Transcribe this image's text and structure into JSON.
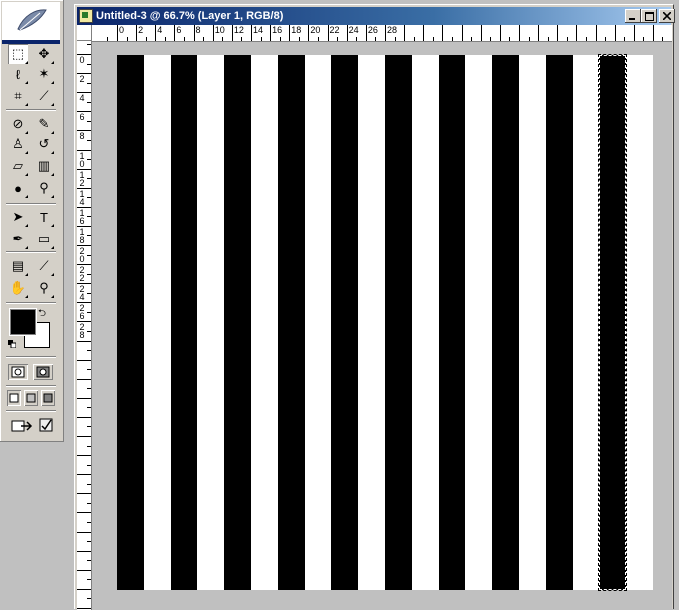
{
  "document": {
    "title": "Untitled-3 @ 66.7% (Layer 1, RGB/8)",
    "window_buttons": {
      "minimize": "_",
      "maximize": "□",
      "close": "×"
    }
  },
  "toolbox": {
    "tools": [
      {
        "name": "rectangular-marquee-tool",
        "icon": "marquee-icon",
        "glyph": "⬚"
      },
      {
        "name": "move-tool",
        "icon": "move-icon",
        "glyph": "✥"
      },
      {
        "name": "lasso-tool",
        "icon": "lasso-icon",
        "glyph": "ℓ"
      },
      {
        "name": "magic-wand-tool",
        "icon": "magic-wand-icon",
        "glyph": "✶"
      },
      {
        "name": "crop-tool",
        "icon": "crop-icon",
        "glyph": "⌗"
      },
      {
        "name": "slice-tool",
        "icon": "slice-icon",
        "glyph": "⟋"
      },
      {
        "name": "healing-brush-tool",
        "icon": "bandage-icon",
        "glyph": "⊘"
      },
      {
        "name": "brush-tool",
        "icon": "brush-icon",
        "glyph": "✎"
      },
      {
        "name": "clone-stamp-tool",
        "icon": "stamp-icon",
        "glyph": "♙"
      },
      {
        "name": "history-brush-tool",
        "icon": "history-brush-icon",
        "glyph": "↺"
      },
      {
        "name": "eraser-tool",
        "icon": "eraser-icon",
        "glyph": "▱"
      },
      {
        "name": "gradient-tool",
        "icon": "gradient-icon",
        "glyph": "▥"
      },
      {
        "name": "blur-tool",
        "icon": "drop-icon",
        "glyph": "●"
      },
      {
        "name": "dodge-tool",
        "icon": "dodge-icon",
        "glyph": "⚲"
      },
      {
        "name": "path-selection-tool",
        "icon": "arrow-icon",
        "glyph": "➤"
      },
      {
        "name": "type-tool",
        "icon": "type-icon",
        "glyph": "T"
      },
      {
        "name": "pen-tool",
        "icon": "pen-icon",
        "glyph": "✒"
      },
      {
        "name": "shape-tool",
        "icon": "rectangle-icon",
        "glyph": "▭"
      },
      {
        "name": "notes-tool",
        "icon": "notes-icon",
        "glyph": "▤"
      },
      {
        "name": "eyedropper-tool",
        "icon": "eyedropper-icon",
        "glyph": "⟋"
      },
      {
        "name": "hand-tool",
        "icon": "hand-icon",
        "glyph": "✋"
      },
      {
        "name": "zoom-tool",
        "icon": "zoom-icon",
        "glyph": "⚲"
      }
    ],
    "foreground_color": "#000000",
    "background_color": "#ffffff"
  },
  "rulers": {
    "horizontal_labels": [
      "0",
      "2",
      "4",
      "6",
      "8",
      "10",
      "12",
      "14",
      "16",
      "18",
      "20",
      "22",
      "24",
      "26",
      "28"
    ],
    "vertical_labels": [
      "0",
      "2",
      "4",
      "6",
      "8",
      "10",
      "12",
      "14",
      "16",
      "18",
      "20",
      "22",
      "24",
      "26",
      "28"
    ]
  },
  "canvas": {
    "stripe_colors": [
      "#000000",
      "#ffffff"
    ],
    "stripe_count": 20,
    "selected_stripe_index": 18
  }
}
